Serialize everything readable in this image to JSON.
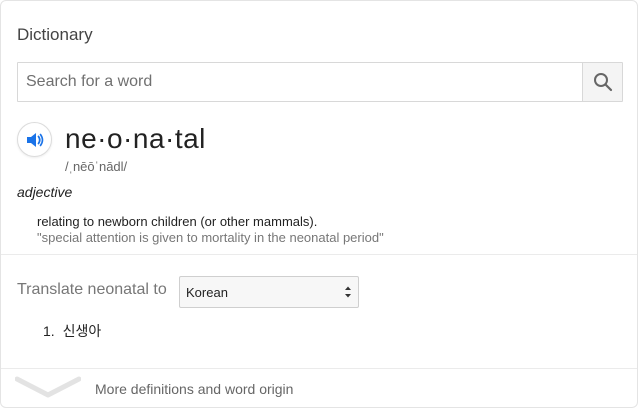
{
  "header": {
    "title": "Dictionary"
  },
  "search": {
    "placeholder": "Search for a word",
    "value": ""
  },
  "entry": {
    "word": "ne·o·na·tal",
    "pronunciation": "/ˌnēōˈnādl/",
    "part_of_speech": "adjective",
    "definition": "relating to newborn children (or other mammals).",
    "example": "\"special attention is given to mortality in the neonatal period\""
  },
  "translate": {
    "label": "Translate neonatal to",
    "selected_language": "Korean",
    "results": [
      {
        "num": "1.",
        "text": "신생아"
      }
    ]
  },
  "footer": {
    "more_label": "More definitions and word origin"
  },
  "colors": {
    "accent": "#1a73e8",
    "muted": "#777777"
  }
}
